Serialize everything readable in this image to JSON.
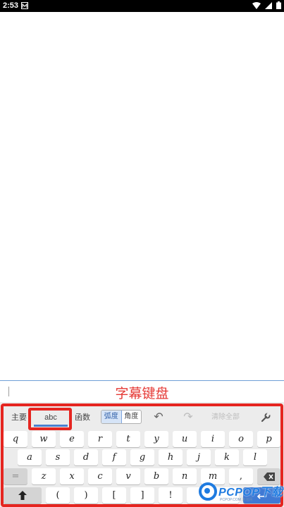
{
  "status_bar": {
    "time": "2:53"
  },
  "input": {
    "caption": "字幕键盘"
  },
  "toolbar": {
    "tab_main": "主要",
    "tab_abc": "abc",
    "tab_functions": "函数",
    "radian": "弧度",
    "degree": "角度",
    "clear_all": "清除全部"
  },
  "keyboard": {
    "row1": [
      "q",
      "w",
      "e",
      "r",
      "t",
      "y",
      "u",
      "i",
      "o",
      "p"
    ],
    "row2": [
      "a",
      "s",
      "d",
      "f",
      "g",
      "h",
      "j",
      "k",
      "l"
    ],
    "row3": [
      "z",
      "x",
      "c",
      "v",
      "b",
      "n",
      "m",
      ","
    ],
    "row4": [
      "(",
      ")",
      "[",
      "]",
      "!"
    ]
  },
  "watermark": {
    "text": "PCPOP下载",
    "sub": "PCPOP.COM 泡泡网"
  },
  "colors": {
    "highlight": "#e52520",
    "accent": "#3f79d4"
  }
}
